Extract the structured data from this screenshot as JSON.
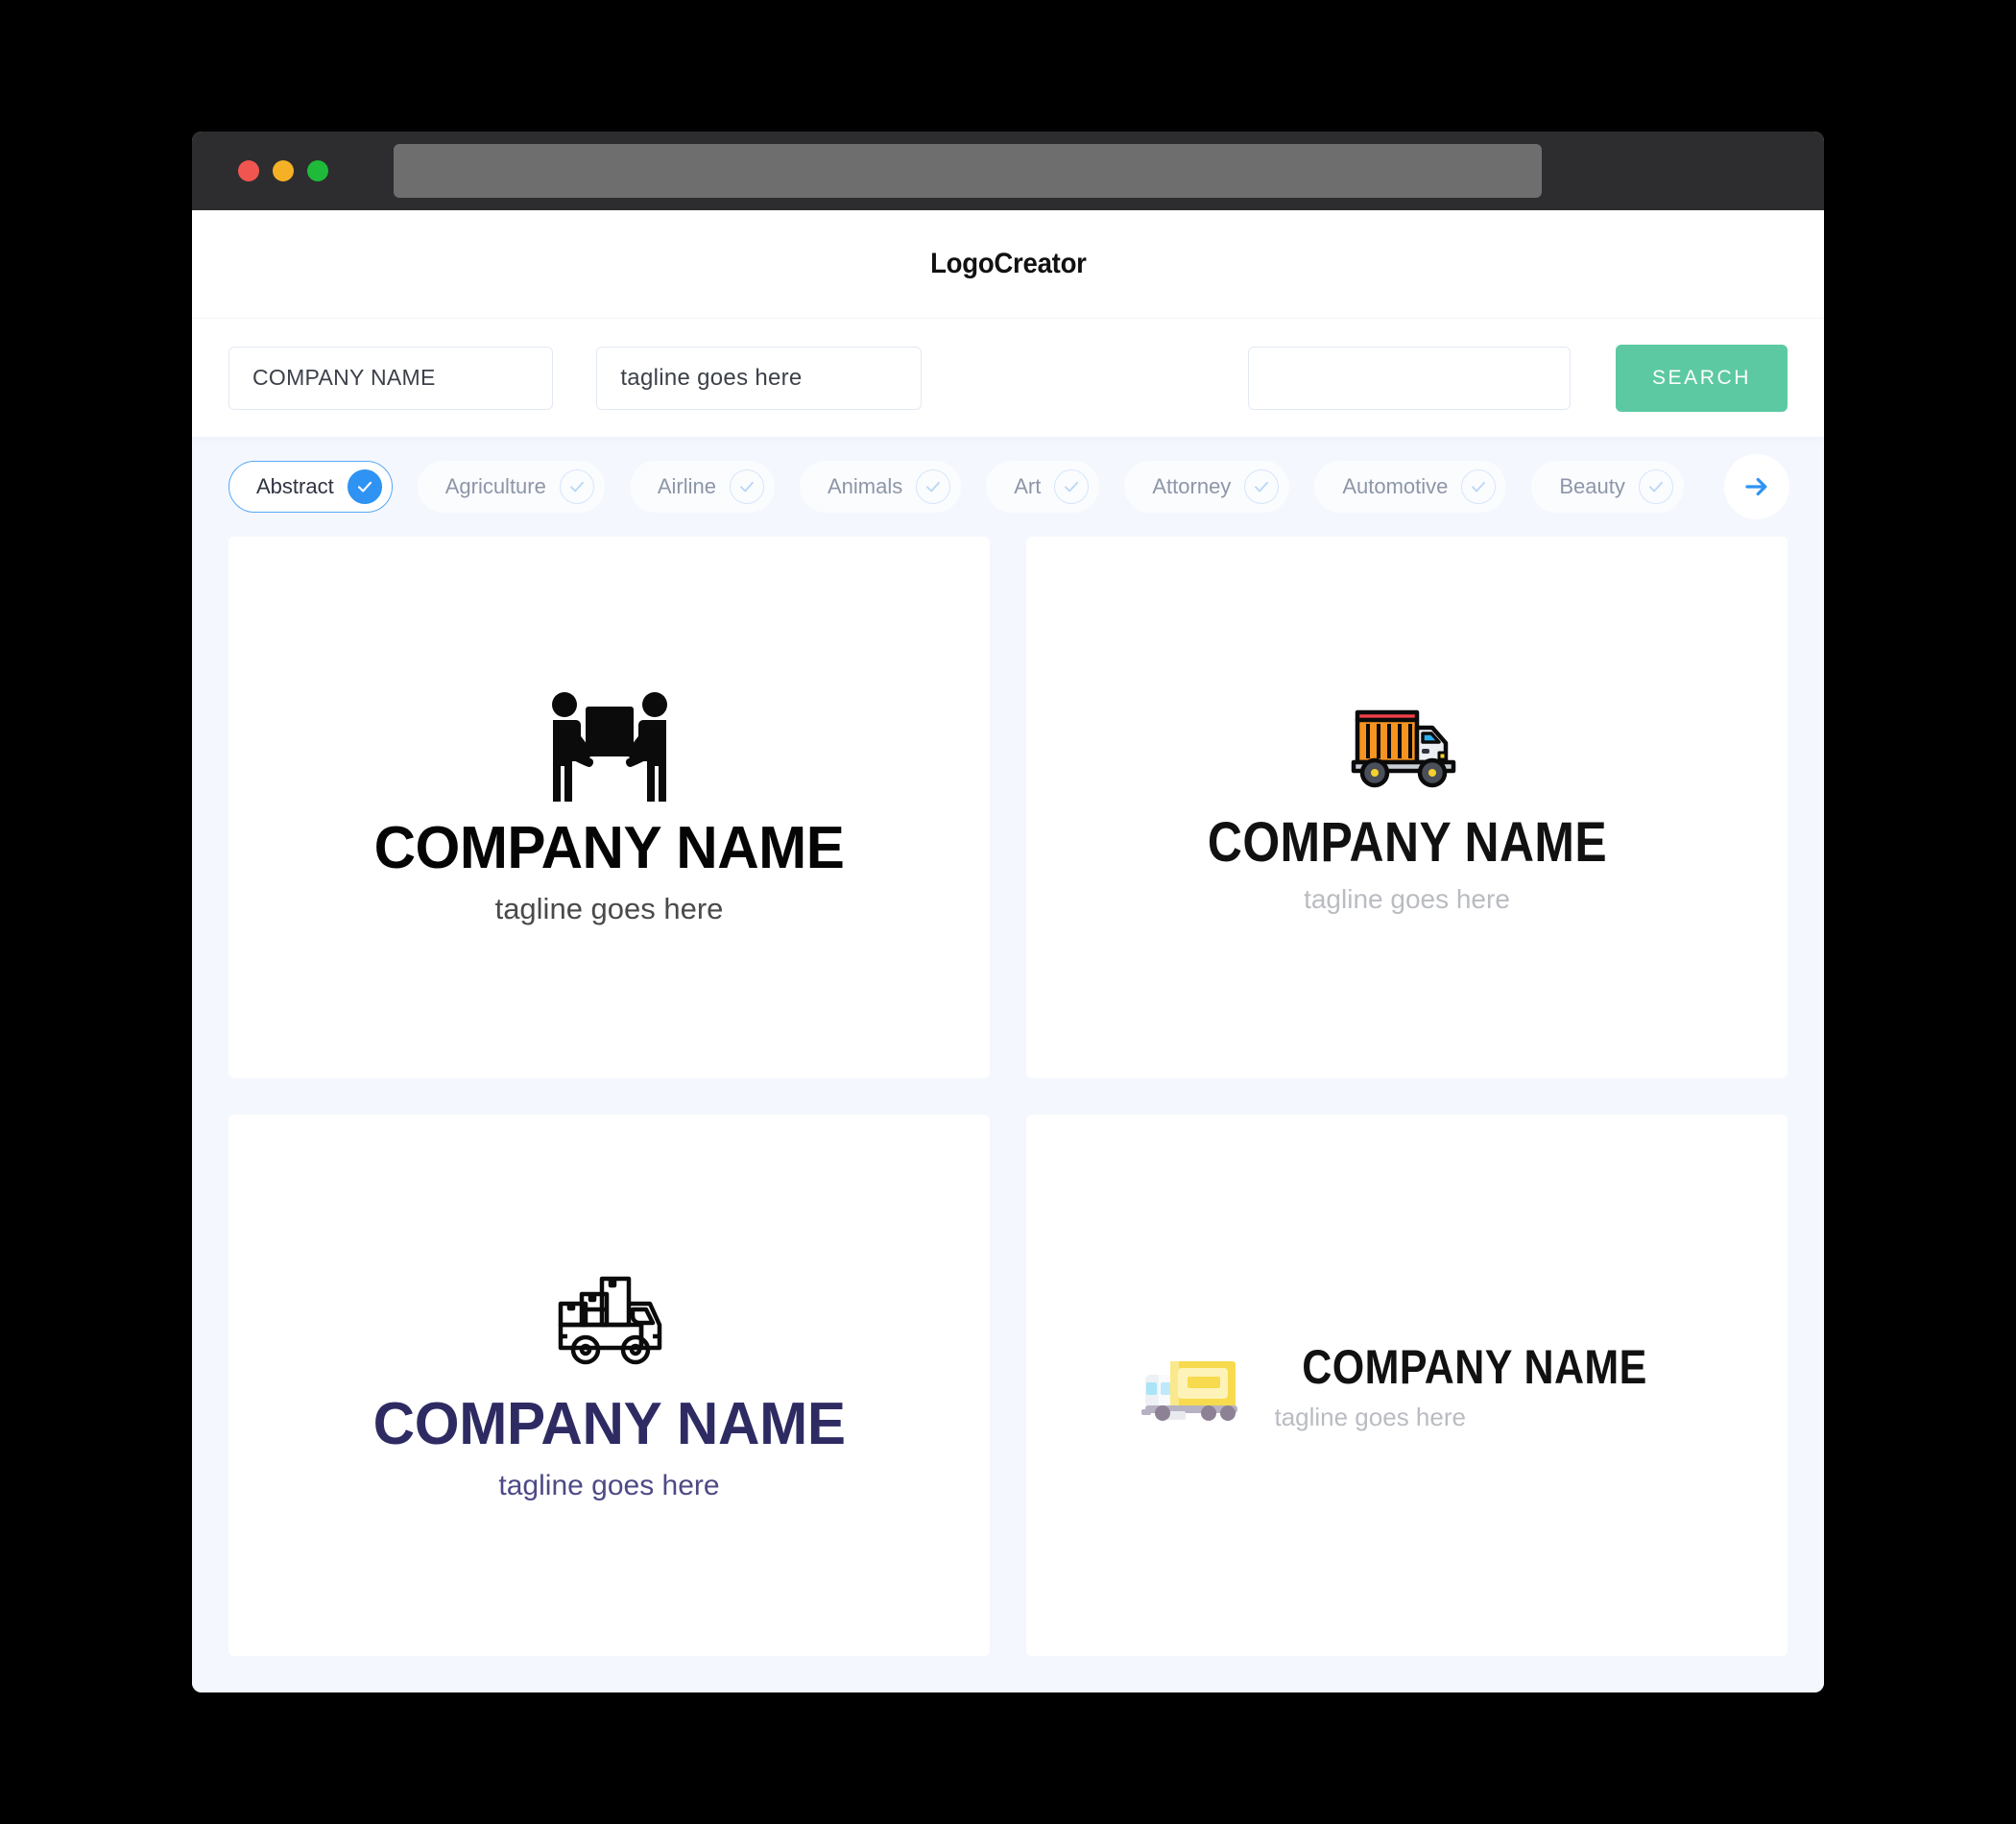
{
  "browser": {
    "window_controls": [
      "close",
      "minimize",
      "maximize"
    ],
    "address_bar_value": ""
  },
  "header": {
    "app_title": "LogoCreator"
  },
  "search": {
    "company_value": "COMPANY NAME",
    "company_placeholder": "COMPANY NAME",
    "tagline_value": "tagline goes here",
    "tagline_placeholder": "tagline goes here",
    "extra_value": "",
    "extra_placeholder": "",
    "search_button": "SEARCH",
    "button_color": "#5cc9a2"
  },
  "categories": {
    "next_arrow_label": "→",
    "items": [
      {
        "label": "Abstract",
        "selected": true
      },
      {
        "label": "Agriculture",
        "selected": false
      },
      {
        "label": "Airline",
        "selected": false
      },
      {
        "label": "Animals",
        "selected": false
      },
      {
        "label": "Art",
        "selected": false
      },
      {
        "label": "Attorney",
        "selected": false
      },
      {
        "label": "Automotive",
        "selected": false
      },
      {
        "label": "Beauty",
        "selected": false
      }
    ],
    "selected_accent": "#2e93f3"
  },
  "results": [
    {
      "icon": "movers-carrying-box-icon",
      "name": "COMPANY NAME",
      "tagline": "tagline goes here",
      "name_color": "#050505",
      "tagline_color": "#4a4a4a",
      "layout": "stacked"
    },
    {
      "icon": "orange-cargo-truck-icon",
      "name": "COMPANY NAME",
      "tagline": "tagline goes here",
      "name_color": "#111111",
      "tagline_color": "#b9bcc1",
      "layout": "stacked"
    },
    {
      "icon": "outline-truck-with-boxes-icon",
      "name": "COMPANY NAME",
      "tagline": "tagline goes here",
      "name_color": "#2e2b63",
      "tagline_color": "#4d4a86",
      "layout": "stacked"
    },
    {
      "icon": "yellow-box-truck-icon",
      "name": "COMPANY NAME",
      "tagline": "tagline goes here",
      "name_color": "#111111",
      "tagline_color": "#b9bcc1",
      "layout": "horizontal"
    }
  ]
}
